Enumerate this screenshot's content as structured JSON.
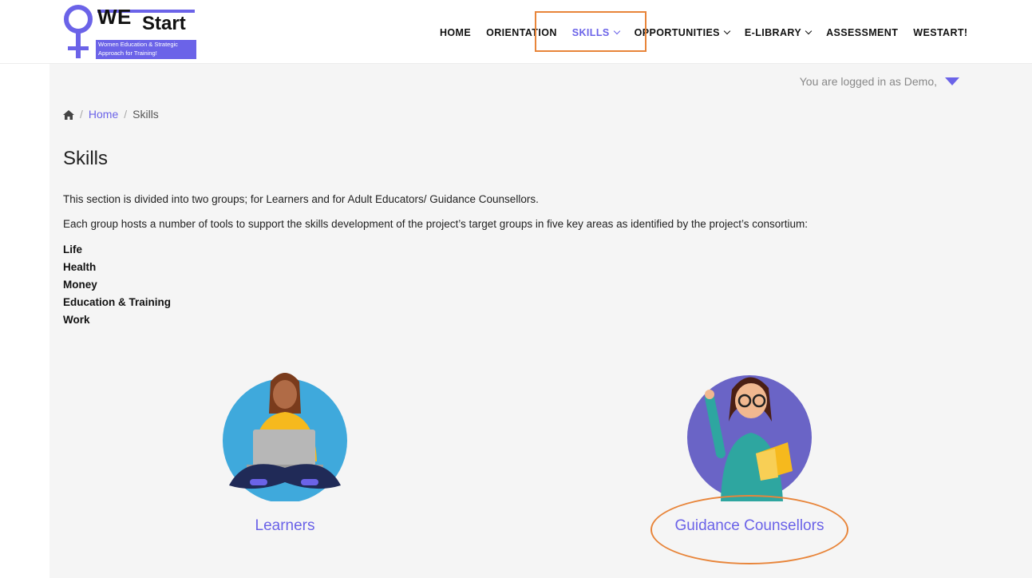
{
  "logo": {
    "word1": "WE",
    "word2": "Start",
    "tagline_line1": "Women Education & Strategic",
    "tagline_line2": "Approach for Training!"
  },
  "nav": [
    {
      "label": "HOME",
      "dropdown": false,
      "active": false
    },
    {
      "label": "ORIENTATION",
      "dropdown": false,
      "active": false
    },
    {
      "label": "SKILLS",
      "dropdown": true,
      "active": true
    },
    {
      "label": "OPPORTUNITIES",
      "dropdown": true,
      "active": false
    },
    {
      "label": "E-LIBRARY",
      "dropdown": true,
      "active": false
    },
    {
      "label": "ASSESSMENT",
      "dropdown": false,
      "active": false
    },
    {
      "label": "WESTART!",
      "dropdown": false,
      "active": false
    }
  ],
  "user": {
    "login_text": "You are logged in as Demo,"
  },
  "breadcrumb": {
    "home": "Home",
    "current": "Skills"
  },
  "page": {
    "title": "Skills",
    "intro": "This section is divided into two groups; for Learners and for Adult Educators/ Guidance Counsellors.",
    "description": "Each group hosts a number of tools to support the skills development of the project’s target groups in five key areas as identified by the project’s consortium:",
    "areas": [
      "Life",
      "Health",
      "Money",
      "Education & Training",
      "Work"
    ]
  },
  "groups": [
    {
      "label": "Learners",
      "illustration": "learner-with-laptop"
    },
    {
      "label": "Guidance Counsellors",
      "illustration": "counsellor-with-book"
    }
  ],
  "colors": {
    "accent": "#6b63e8",
    "highlight": "#e8853a",
    "panel": "#f5f5f5",
    "learner_circle": "#3fa9dc",
    "counsellor_circle": "#6a64c6"
  }
}
